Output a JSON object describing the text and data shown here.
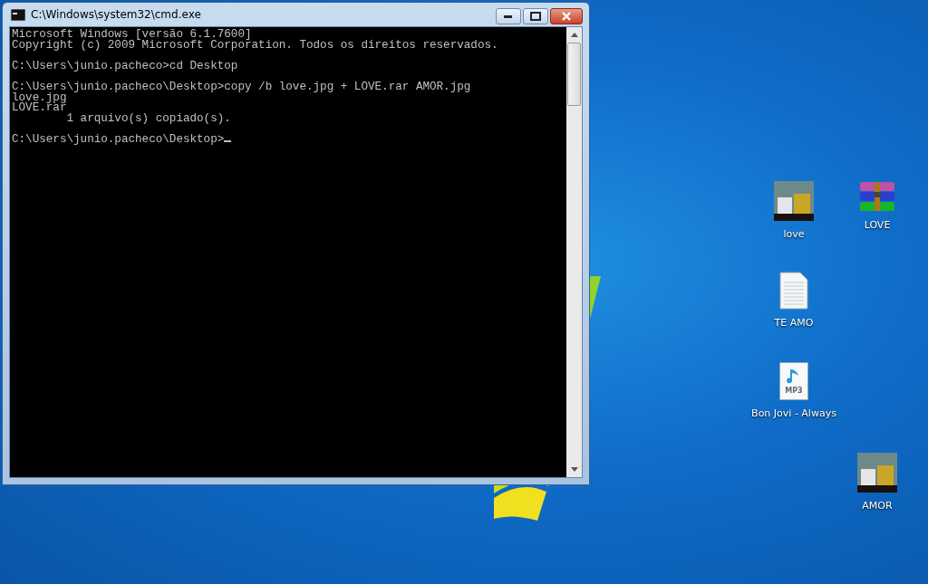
{
  "window": {
    "title": "C:\\Windows\\system32\\cmd.exe"
  },
  "console": {
    "blocks": [
      [
        "Microsoft Windows [versão 6.1.7600]",
        "Copyright (c) 2009 Microsoft Corporation. Todos os direitos reservados."
      ],
      [
        "C:\\Users\\junio.pacheco>cd Desktop"
      ],
      [
        "C:\\Users\\junio.pacheco\\Desktop>copy /b love.jpg + LOVE.rar AMOR.jpg",
        "love.jpg",
        "LOVE.rar",
        "        1 arquivo(s) copiado(s)."
      ],
      [
        "C:\\Users\\junio.pacheco\\Desktop>"
      ]
    ],
    "cursor_visible": true
  },
  "desktop_icons": [
    {
      "kind": "image",
      "label": "love"
    },
    {
      "kind": "archive",
      "label": "LOVE"
    },
    {
      "kind": "text",
      "label": "TE AMO"
    },
    {
      "kind": "audio",
      "label": "Bon Jovi - Always",
      "icon_text": "MP3"
    },
    {
      "kind": "image",
      "label": "AMOR"
    }
  ]
}
